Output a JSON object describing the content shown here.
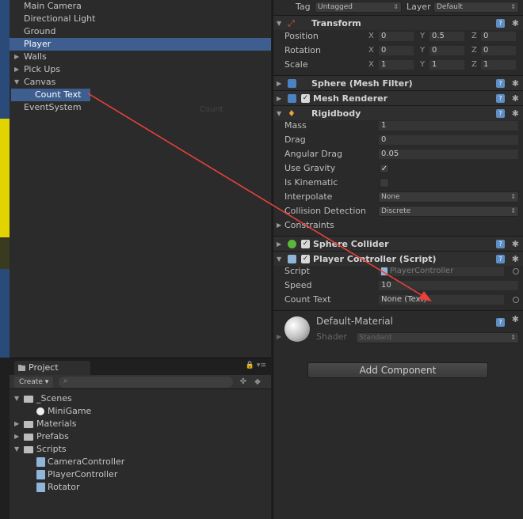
{
  "hierarchy": {
    "items": [
      {
        "label": "Main Camera",
        "arrow": ""
      },
      {
        "label": "Directional Light",
        "arrow": ""
      },
      {
        "label": "Ground",
        "arrow": ""
      },
      {
        "label": "Player",
        "arrow": "",
        "selected": true
      },
      {
        "label": "Walls",
        "arrow": "▶"
      },
      {
        "label": "Pick Ups",
        "arrow": "▶"
      },
      {
        "label": "Canvas",
        "arrow": "▼"
      },
      {
        "label": "Count Text",
        "arrow": "",
        "selected": true
      },
      {
        "label": "EventSystem",
        "arrow": ""
      }
    ],
    "ghost_label": "Count"
  },
  "project": {
    "tab_label": "Project",
    "create_label": "Create ▾",
    "items": [
      {
        "label": "_Scenes",
        "arrow": "▼"
      },
      {
        "label": "MiniGame",
        "arrow": ""
      },
      {
        "label": "Materials",
        "arrow": "▶"
      },
      {
        "label": "Prefabs",
        "arrow": "▶"
      },
      {
        "label": "Scripts",
        "arrow": "▼"
      },
      {
        "label": "CameraController",
        "arrow": ""
      },
      {
        "label": "PlayerController",
        "arrow": ""
      },
      {
        "label": "Rotator",
        "arrow": ""
      }
    ]
  },
  "inspector": {
    "tag_label": "Tag",
    "tag_value": "Untagged",
    "layer_label": "Layer",
    "layer_value": "Default",
    "transform": {
      "title": "Transform",
      "position": {
        "label": "Position",
        "x": "0",
        "y": "0.5",
        "z": "0"
      },
      "rotation": {
        "label": "Rotation",
        "x": "0",
        "y": "0",
        "z": "0"
      },
      "scale": {
        "label": "Scale",
        "x": "1",
        "y": "1",
        "z": "1"
      }
    },
    "axes": {
      "x": "X",
      "y": "Y",
      "z": "Z"
    },
    "mesh_filter": {
      "title": "Sphere (Mesh Filter)"
    },
    "mesh_renderer": {
      "title": "Mesh Renderer"
    },
    "rigidbody": {
      "title": "Rigidbody",
      "mass": {
        "label": "Mass",
        "value": "1"
      },
      "drag": {
        "label": "Drag",
        "value": "0"
      },
      "angular_drag": {
        "label": "Angular Drag",
        "value": "0.05"
      },
      "use_gravity": {
        "label": "Use Gravity",
        "checked": true
      },
      "is_kinematic": {
        "label": "Is Kinematic",
        "checked": false
      },
      "interpolate": {
        "label": "Interpolate",
        "value": "None"
      },
      "collision_detection": {
        "label": "Collision Detection",
        "value": "Discrete"
      },
      "constraints": {
        "label": "Constraints"
      }
    },
    "sphere_collider": {
      "title": "Sphere Collider"
    },
    "player_controller": {
      "title": "Player Controller (Script)",
      "script": {
        "label": "Script",
        "value": "PlayerController"
      },
      "speed": {
        "label": "Speed",
        "value": "10"
      },
      "count_text": {
        "label": "Count Text",
        "value": "None (Text)"
      }
    },
    "material": {
      "name": "Default-Material",
      "shader_label": "Shader",
      "shader_value": "Standard"
    },
    "add_component_label": "Add Component"
  },
  "colors": {
    "accent": "#3d5e8f",
    "arrow": "#e8403a",
    "help": "#5d8fc4"
  }
}
